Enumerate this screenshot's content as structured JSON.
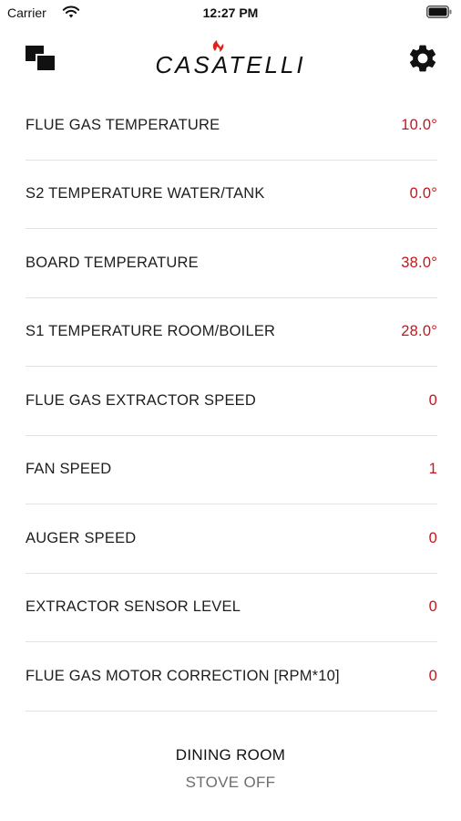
{
  "status_bar": {
    "carrier": "Carrier",
    "time": "12:27 PM",
    "wifi_icon": "wifi-icon",
    "battery_icon": "battery-icon"
  },
  "nav": {
    "left_icon": "screens-icon",
    "logo_text": "CASATELLI",
    "right_icon": "gear-icon"
  },
  "colors": {
    "value_red": "#c8141b",
    "logo_flame": "#e2231a",
    "divider": "#e3e3e3"
  },
  "parameters": [
    {
      "label": "FLUE GAS TEMPERATURE",
      "value": "10.0°"
    },
    {
      "label": "S2 TEMPERATURE WATER/TANK",
      "value": "0.0°"
    },
    {
      "label": "BOARD TEMPERATURE",
      "value": "38.0°"
    },
    {
      "label": "S1 TEMPERATURE ROOM/BOILER",
      "value": "28.0°"
    },
    {
      "label": "FLUE GAS EXTRACTOR SPEED",
      "value": "0"
    },
    {
      "label": "FAN SPEED",
      "value": "1"
    },
    {
      "label": "AUGER SPEED",
      "value": "0"
    },
    {
      "label": "EXTRACTOR SENSOR LEVEL",
      "value": "0"
    },
    {
      "label": "FLUE GAS MOTOR CORRECTION [RPM*10]",
      "value": "0"
    }
  ],
  "footer": {
    "room": "DINING ROOM",
    "status": "STOVE OFF"
  }
}
